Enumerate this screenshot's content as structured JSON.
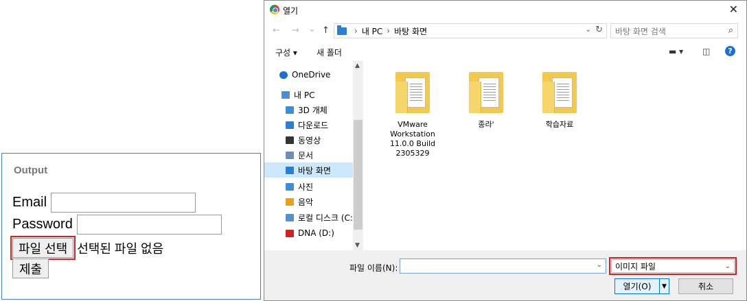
{
  "output": {
    "title": "Output",
    "email_label": "Email",
    "email_value": "",
    "password_label": "Password",
    "password_value": "",
    "file_button_label": "파일 선택",
    "file_status": "선택된 파일 없음",
    "submit_label": "제출"
  },
  "dialog": {
    "title": "열기",
    "close_glyph": "✕",
    "nav": {
      "back": "←",
      "forward": "→",
      "recent": "⌄",
      "up": "↑",
      "breadcrumbs": [
        "내 PC",
        "바탕 화면"
      ],
      "search_placeholder": "바탕 화면 검색"
    },
    "toolbar": {
      "organize": "구성 ▾",
      "new_folder": "새 폴더",
      "view": "▬ ▾",
      "preview": "◫",
      "help": "?"
    },
    "sidebar": [
      {
        "label": "OneDrive",
        "icon": "cloud-icon",
        "color": "#1f6fd1"
      },
      {
        "label": "내 PC",
        "icon": "computer-icon",
        "color": "#4a8fd8"
      },
      {
        "label": "3D 개체",
        "icon": "cube-icon",
        "color": "#3b8fd8"
      },
      {
        "label": "다운로드",
        "icon": "download-icon",
        "color": "#2a7fd4"
      },
      {
        "label": "동영상",
        "icon": "video-icon",
        "color": "#333333"
      },
      {
        "label": "문서",
        "icon": "document-icon",
        "color": "#6b8fb8"
      },
      {
        "label": "바탕 화면",
        "icon": "desktop-icon",
        "color": "#2a7fd4"
      },
      {
        "label": "사진",
        "icon": "pictures-icon",
        "color": "#3b8fd8"
      },
      {
        "label": "음악",
        "icon": "music-icon",
        "color": "#e8a21a"
      },
      {
        "label": "로컬 디스크 (C:)",
        "icon": "drive-icon",
        "color": "#5a8fc8"
      },
      {
        "label": "DNA (D:)",
        "icon": "drive-download-icon",
        "color": "#d32121"
      }
    ],
    "files": [
      {
        "name": "VMware Workstation 11.0.0 Build 2305329"
      },
      {
        "name": "종라'"
      },
      {
        "name": "학습자료"
      }
    ],
    "bottom": {
      "filename_label": "파일 이름(N):",
      "filename_value": "",
      "filter_value": "이미지 파일",
      "open_label": "열기(O)",
      "cancel_label": "취소"
    }
  }
}
